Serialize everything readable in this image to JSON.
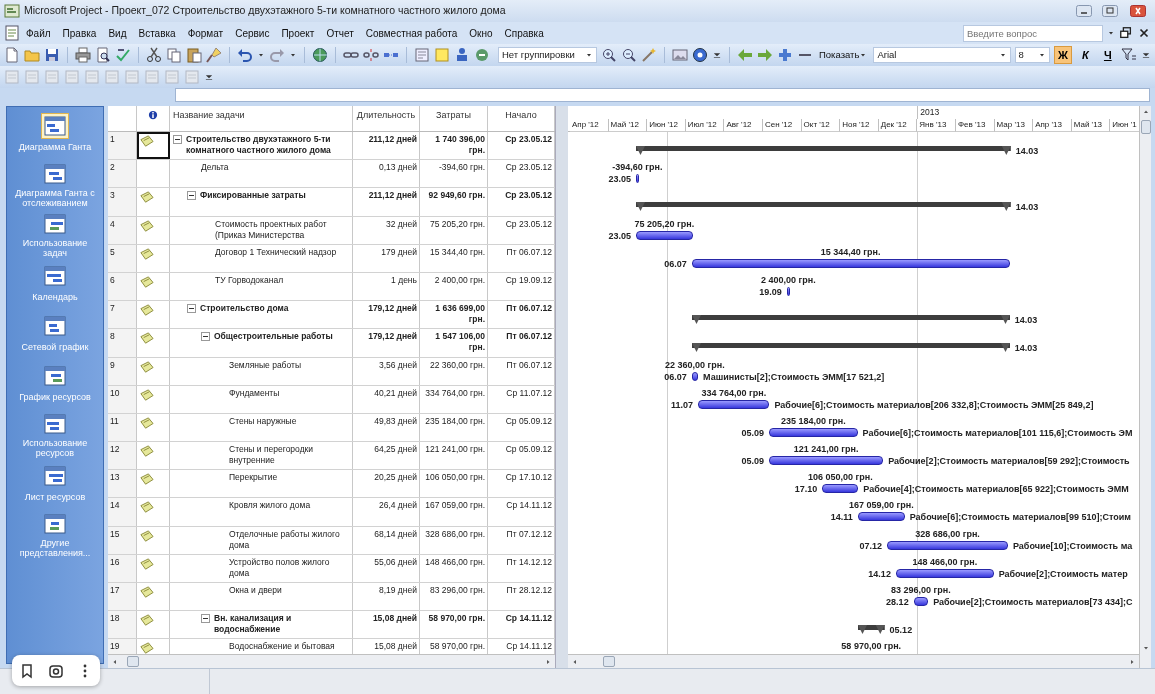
{
  "window": {
    "title": "Microsoft Project - Проект_072 Строительство двухэтажного 5-ти комнатного частного жилого дома"
  },
  "menu": [
    "Файл",
    "Правка",
    "Вид",
    "Вставка",
    "Формат",
    "Сервис",
    "Проект",
    "Отчет",
    "Совместная работа",
    "Окно",
    "Справка"
  ],
  "help_field": {
    "placeholder": "Введите вопрос"
  },
  "toolbar": {
    "grouping": "Нет группировки",
    "show_button": "Показать",
    "font": "Arial",
    "font_size": "8",
    "format_buttons": [
      {
        "label": "Ж",
        "kind": "bold",
        "selected": true
      },
      {
        "label": "К",
        "kind": "italic",
        "selected": false
      },
      {
        "label": "Ч",
        "kind": "underline",
        "selected": false
      }
    ]
  },
  "sidebar": {
    "items": [
      {
        "label": "Диаграмма Ганта",
        "selected": true
      },
      {
        "label": "Диаграмма Ганта с отслеживанием",
        "selected": false
      },
      {
        "label": "Использование задач",
        "selected": false
      },
      {
        "label": "Календарь",
        "selected": false
      },
      {
        "label": "Сетевой график",
        "selected": false
      },
      {
        "label": "График ресурсов",
        "selected": false
      },
      {
        "label": "Использование ресурсов",
        "selected": false
      },
      {
        "label": "Лист ресурсов",
        "selected": false
      },
      {
        "label": "Другие представления...",
        "selected": false
      }
    ]
  },
  "table": {
    "columns": [
      "Название задачи",
      "Длительность",
      "Затраты",
      "Начало"
    ]
  },
  "tasks": [
    {
      "id": "1",
      "name": "Строительство двухэтажного 5-ти комнатного частного жилого дома",
      "duration": "211,12 дней",
      "cost": "1 740 396,00 грн.",
      "start": "Ср 23.05.12",
      "note_icon": true,
      "selected": true,
      "expanded": true,
      "gantt": {
        "end_label": "14.03"
      },
      "children": [
        {
          "id": "2",
          "name": "Дельта",
          "duration": "0,13 дней",
          "cost": "-394,60 грн.",
          "start": "Ср 23.05.12",
          "note_icon": false,
          "selected": false,
          "gantt": {
            "cost_label": "-394,60 грн.",
            "start_label": "23.05"
          }
        },
        {
          "id": "3",
          "name": "Фиксированные затраты",
          "duration": "211,12 дней",
          "cost": "92 949,60 грн.",
          "start": "Ср 23.05.12",
          "note_icon": true,
          "selected": false,
          "expanded": true,
          "gantt": {
            "end_label": "14.03"
          },
          "children": [
            {
              "id": "4",
              "name": "Стоимость проектных работ (Приказ Министерства",
              "duration": "32 дней",
              "cost": "75 205,20 грн.",
              "start": "Ср 23.05.12",
              "note_icon": true,
              "selected": false,
              "gantt": {
                "cost_label": "75 205,20 грн.",
                "start_label": "23.05"
              }
            },
            {
              "id": "5",
              "name": "Договор 1 Технический надзор",
              "duration": "179 дней",
              "cost": "15 344,40 грн.",
              "start": "Пт 06.07.12",
              "note_icon": true,
              "selected": false,
              "gantt": {
                "cost_label": "15 344,40 грн.",
                "start_label": "06.07"
              }
            },
            {
              "id": "6",
              "name": "ТУ Горводоканал",
              "duration": "1 день",
              "cost": "2 400,00 грн.",
              "start": "Ср 19.09.12",
              "note_icon": true,
              "selected": false,
              "gantt": {
                "cost_label": "2 400,00 грн.",
                "start_label": "19.09"
              }
            }
          ]
        },
        {
          "id": "7",
          "name": "Строительство дома",
          "duration": "179,12 дней",
          "cost": "1 636 699,00 грн.",
          "start": "Пт 06.07.12",
          "note_icon": true,
          "selected": false,
          "expanded": true,
          "gantt": {
            "end_label": "14.03"
          },
          "children": [
            {
              "id": "8",
              "name": "Общестроительные работы",
              "duration": "179,12 дней",
              "cost": "1 547 106,00 грн.",
              "start": "Пт 06.07.12",
              "note_icon": true,
              "selected": false,
              "expanded": true,
              "gantt": {
                "end_label": "14.03"
              },
              "children": [
                {
                  "id": "9",
                  "name": "Земляные работы",
                  "duration": "3,56 дней",
                  "cost": "22 360,00 грн.",
                  "start": "Пт 06.07.12",
                  "note_icon": true,
                  "selected": false,
                  "gantt": {
                    "cost_label": "22 360,00 грн.",
                    "start_label": "06.07",
                    "resources": "Машинисты[2];Стоимость ЭММ[17 521,2]"
                  }
                },
                {
                  "id": "10",
                  "name": "Фундаменты",
                  "duration": "40,21 дней",
                  "cost": "334 764,00 грн.",
                  "start": "Ср 11.07.12",
                  "note_icon": true,
                  "selected": false,
                  "gantt": {
                    "cost_label": "334 764,00 грн.",
                    "start_label": "11.07",
                    "resources": "Рабочие[6];Стоимость материалов[206 332,8];Стоимость ЭММ[25 849,2]"
                  }
                },
                {
                  "id": "11",
                  "name": "Стены наружные",
                  "duration": "49,83 дней",
                  "cost": "235 184,00 грн.",
                  "start": "Ср 05.09.12",
                  "note_icon": true,
                  "selected": false,
                  "gantt": {
                    "cost_label": "235 184,00 грн.",
                    "start_label": "05.09",
                    "resources": "Рабочие[6];Стоимость материалов[101 115,6];Стоимость ЭМ"
                  }
                },
                {
                  "id": "12",
                  "name": "Стены и перегородки внутренние",
                  "duration": "64,25 дней",
                  "cost": "121 241,00 грн.",
                  "start": "Ср 05.09.12",
                  "note_icon": true,
                  "selected": false,
                  "gantt": {
                    "cost_label": "121 241,00 грн.",
                    "start_label": "05.09",
                    "resources": "Рабочие[2];Стоимость материалов[59 292];Стоимость"
                  }
                },
                {
                  "id": "13",
                  "name": "Перекрытие",
                  "duration": "20,25 дней",
                  "cost": "106 050,00 грн.",
                  "start": "Ср 17.10.12",
                  "note_icon": true,
                  "selected": false,
                  "gantt": {
                    "cost_label": "106 050,00 грн.",
                    "start_label": "17.10",
                    "resources": "Рабочие[4];Стоимость материалов[65 922];Стоимость ЭММ"
                  }
                },
                {
                  "id": "14",
                  "name": "Кровля жилого дома",
                  "duration": "26,4 дней",
                  "cost": "167 059,00 грн.",
                  "start": "Ср 14.11.12",
                  "note_icon": true,
                  "selected": false,
                  "gantt": {
                    "cost_label": "167 059,00 грн.",
                    "start_label": "14.11",
                    "resources": "Рабочие[6];Стоимость материалов[99 510];Стоим"
                  }
                },
                {
                  "id": "15",
                  "name": "Отделочные работы жилого дома",
                  "duration": "68,14 дней",
                  "cost": "328 686,00 грн.",
                  "start": "Пт 07.12.12",
                  "note_icon": true,
                  "selected": false,
                  "gantt": {
                    "cost_label": "328 686,00 грн.",
                    "start_label": "07.12",
                    "resources": "Рабочие[10];Стоимость ма"
                  }
                },
                {
                  "id": "16",
                  "name": "Устройство полов жилого дома",
                  "duration": "55,06 дней",
                  "cost": "148 466,00 грн.",
                  "start": "Пт 14.12.12",
                  "note_icon": true,
                  "selected": false,
                  "gantt": {
                    "cost_label": "148 466,00 грн.",
                    "start_label": "14.12",
                    "resources": "Рабочие[2];Стоимость матер"
                  }
                },
                {
                  "id": "17",
                  "name": "Окна и двери",
                  "duration": "8,19 дней",
                  "cost": "83 296,00 грн.",
                  "start": "Пт 28.12.12",
                  "note_icon": true,
                  "selected": false,
                  "gantt": {
                    "cost_label": "83 296,00 грн.",
                    "start_label": "28.12",
                    "resources": "Рабочие[2];Стоимость материалов[73 434];С"
                  }
                }
              ]
            },
            {
              "id": "18",
              "name": "Вн. канализация и водоснабжение",
              "duration": "15,08 дней",
              "cost": "58 970,00 грн.",
              "start": "Ср 14.11.12",
              "note_icon": true,
              "selected": false,
              "expanded": true,
              "gantt": {
                "end_label": "05.12"
              },
              "children": [
                {
                  "id": "19",
                  "name": "Водоснабжение и бытовая",
                  "duration": "15,08 дней",
                  "cost": "58 970,00 грн.",
                  "start": "Ср 14.11.12",
                  "note_icon": true,
                  "selected": false,
                  "gantt": {
                    "cost_label": "58 970,00 грн.",
                    "bar": false
                  }
                }
              ]
            }
          ]
        }
      ]
    }
  ],
  "timescale": {
    "months": [
      {
        "label": "Апр '12"
      },
      {
        "label": "Май '12"
      },
      {
        "label": "Июн '12"
      },
      {
        "label": "Июл '12"
      },
      {
        "label": "Авг '12"
      },
      {
        "label": "Сен '12"
      },
      {
        "label": "Окт '12"
      },
      {
        "label": "Ноя '12"
      },
      {
        "label": "Дек '12"
      },
      {
        "label": "Янв '13",
        "year_label": "2013"
      },
      {
        "label": "Фев '13"
      },
      {
        "label": "Мар '13"
      },
      {
        "label": "Апр '13"
      },
      {
        "label": "Май '13"
      },
      {
        "label": "Июн '1"
      }
    ]
  }
}
